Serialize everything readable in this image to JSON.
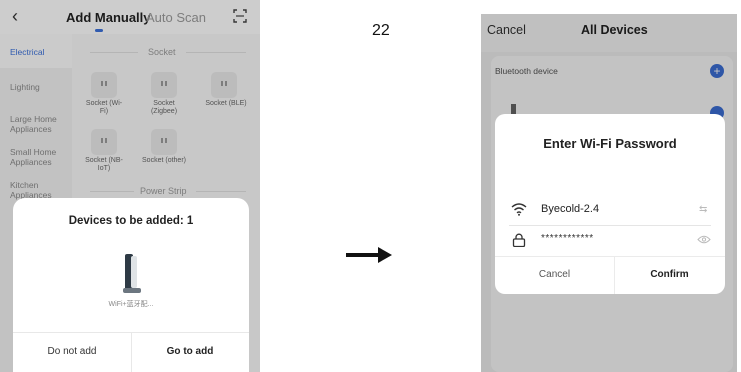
{
  "step_number": "22",
  "left_screen": {
    "tabs": {
      "manual": "Add Manually",
      "auto": "Auto Scan"
    },
    "sidebar": [
      {
        "label": "Electrical",
        "active": true
      },
      {
        "label": "Lighting"
      },
      {
        "label": "Large Home Appliances"
      },
      {
        "label": "Small Home Appliances"
      },
      {
        "label": "Kitchen Appliances"
      }
    ],
    "section_socket": "Socket",
    "section_power_strip": "Power Strip",
    "devices": [
      {
        "label": "Socket (Wi-Fi)"
      },
      {
        "label": "Socket (Zigbee)"
      },
      {
        "label": "Socket (BLE)"
      },
      {
        "label": "Socket (NB-IoT)"
      },
      {
        "label": "Socket (other)"
      }
    ],
    "sheet": {
      "title": "Devices to be added: 1",
      "device_name": "WiFi+蓝牙配...",
      "btn_not_add": "Do not add",
      "btn_go_to_add": "Go to add"
    }
  },
  "right_screen": {
    "header": {
      "cancel": "Cancel",
      "title": "All Devices"
    },
    "bluetooth_label": "Bluetooth device",
    "dialog": {
      "title": "Enter Wi-Fi Password",
      "ssid": "Byecold-2.4",
      "password": "************",
      "btn_cancel": "Cancel",
      "btn_confirm": "Confirm"
    }
  },
  "colors": {
    "accent": "#3b6fd6"
  }
}
